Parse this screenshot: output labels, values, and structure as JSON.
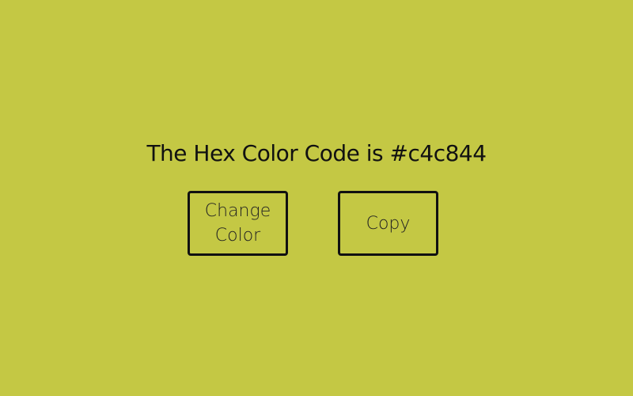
{
  "page": {
    "background_color": "#c4c844",
    "text_color": "#111111"
  },
  "header": {
    "prefix": "The Hex Color Code is ",
    "hex_value": "#c4c844"
  },
  "buttons": {
    "change_label": "Change Color",
    "copy_label": "Copy"
  }
}
